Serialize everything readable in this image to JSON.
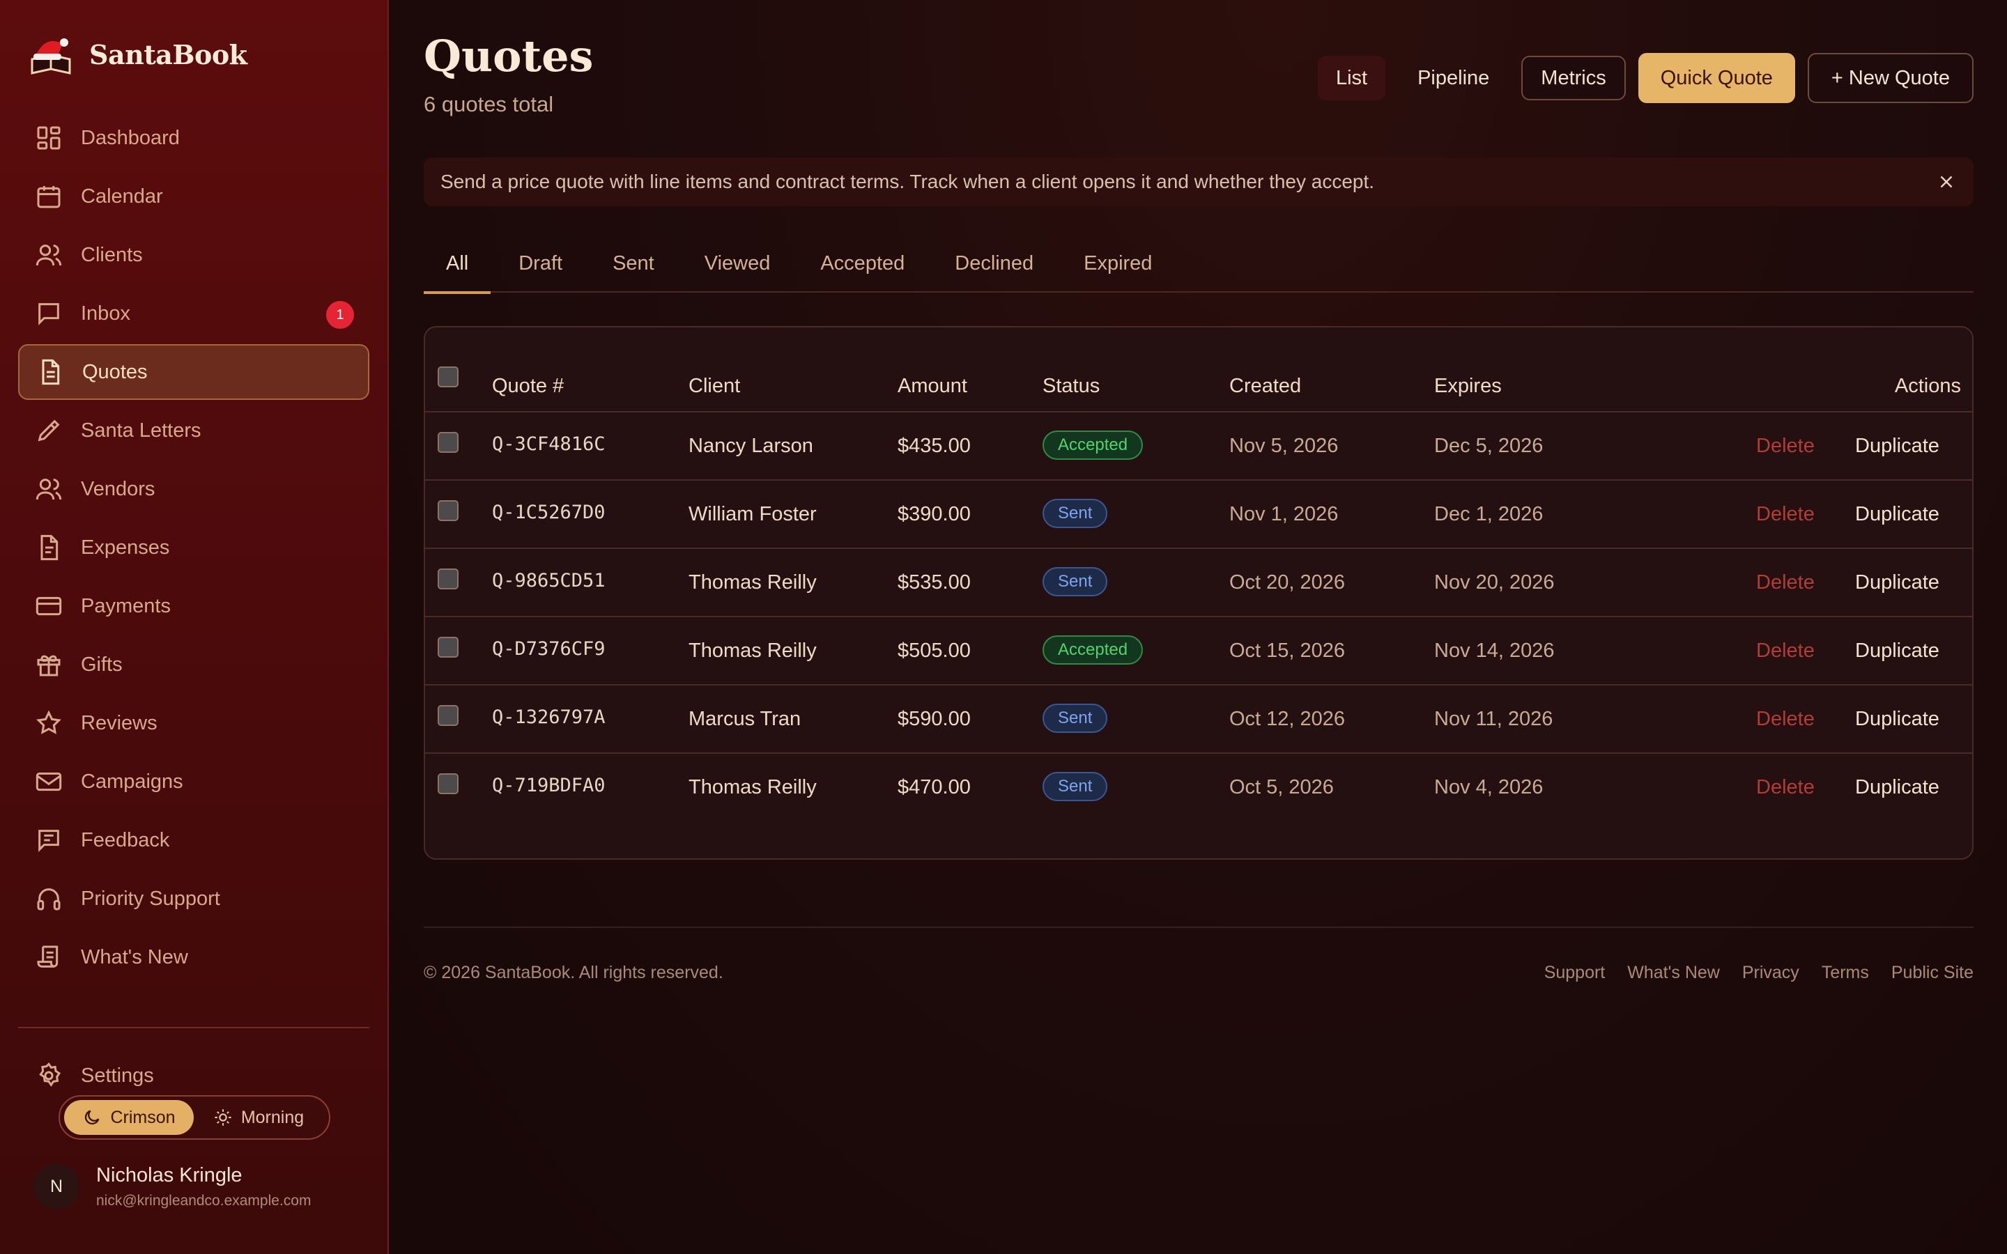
{
  "brand": {
    "name": "SantaBook"
  },
  "sidebar": {
    "items": [
      {
        "label": "Dashboard",
        "icon": "dashboard-icon"
      },
      {
        "label": "Calendar",
        "icon": "calendar-icon"
      },
      {
        "label": "Clients",
        "icon": "users-icon"
      },
      {
        "label": "Inbox",
        "icon": "message-icon",
        "badge": "1"
      },
      {
        "label": "Quotes",
        "icon": "document-icon",
        "active": true
      },
      {
        "label": "Santa Letters",
        "icon": "pen-icon"
      },
      {
        "label": "Vendors",
        "icon": "users-icon"
      },
      {
        "label": "Expenses",
        "icon": "receipt-icon"
      },
      {
        "label": "Payments",
        "icon": "credit-card-icon"
      },
      {
        "label": "Gifts",
        "icon": "gift-icon"
      },
      {
        "label": "Reviews",
        "icon": "star-icon"
      },
      {
        "label": "Campaigns",
        "icon": "mail-icon"
      },
      {
        "label": "Feedback",
        "icon": "feedback-icon"
      },
      {
        "label": "Priority Support",
        "icon": "headphones-icon"
      },
      {
        "label": "What's New",
        "icon": "scroll-icon"
      }
    ],
    "settings": {
      "label": "Settings",
      "icon": "gear-icon"
    },
    "theme": {
      "active": "Crimson",
      "inactive": "Morning"
    },
    "user": {
      "initial": "N",
      "name": "Nicholas Kringle",
      "email": "nick@kringleandco.example.com"
    }
  },
  "header": {
    "title": "Quotes",
    "subtitle": "6 quotes total",
    "views": [
      "List",
      "Pipeline",
      "Metrics"
    ],
    "quick_quote": "Quick Quote",
    "new_quote": "+ New Quote"
  },
  "banner": {
    "text": "Send a price quote with line items and contract terms. Track when a client opens it and whether they accept."
  },
  "tabs": [
    "All",
    "Draft",
    "Sent",
    "Viewed",
    "Accepted",
    "Declined",
    "Expired"
  ],
  "table": {
    "columns": [
      "Quote #",
      "Client",
      "Amount",
      "Status",
      "Created",
      "Expires",
      "Actions"
    ],
    "rows": [
      {
        "id": "Q-3CF4816C",
        "client": "Nancy Larson",
        "amount": "$435.00",
        "status": "Accepted",
        "created": "Nov 5, 2026",
        "expires": "Dec 5, 2026"
      },
      {
        "id": "Q-1C5267D0",
        "client": "William Foster",
        "amount": "$390.00",
        "status": "Sent",
        "created": "Nov 1, 2026",
        "expires": "Dec 1, 2026"
      },
      {
        "id": "Q-9865CD51",
        "client": "Thomas Reilly",
        "amount": "$535.00",
        "status": "Sent",
        "created": "Oct 20, 2026",
        "expires": "Nov 20, 2026"
      },
      {
        "id": "Q-D7376CF9",
        "client": "Thomas Reilly",
        "amount": "$505.00",
        "status": "Accepted",
        "created": "Oct 15, 2026",
        "expires": "Nov 14, 2026"
      },
      {
        "id": "Q-1326797A",
        "client": "Marcus Tran",
        "amount": "$590.00",
        "status": "Sent",
        "created": "Oct 12, 2026",
        "expires": "Nov 11, 2026"
      },
      {
        "id": "Q-719BDFA0",
        "client": "Thomas Reilly",
        "amount": "$470.00",
        "status": "Sent",
        "created": "Oct 5, 2026",
        "expires": "Nov 4, 2026"
      }
    ],
    "actions": {
      "delete": "Delete",
      "duplicate": "Duplicate"
    }
  },
  "footer": {
    "copyright": "© 2026 SantaBook. All rights reserved.",
    "links": [
      "Support",
      "What's New",
      "Privacy",
      "Terms",
      "Public Site"
    ]
  },
  "colors": {
    "accent": "#e6b568",
    "sidebar": "#5c0c0d",
    "danger": "#e52434",
    "accepted": "#53d36d",
    "sent": "#7ea4ee"
  }
}
